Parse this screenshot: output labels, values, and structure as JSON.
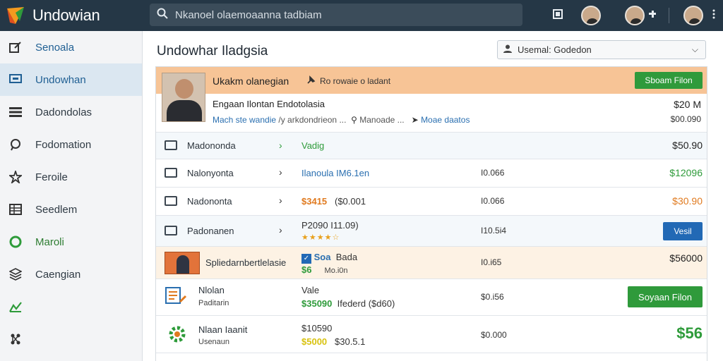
{
  "app": {
    "title": "Undowian",
    "search_text": "Nkanoel olaemoaanna tadbiam"
  },
  "sidebar": {
    "items": [
      {
        "label": "Senoala",
        "icon": "edit-icon"
      },
      {
        "label": "Undowhan",
        "icon": "monitor-icon",
        "active": true
      },
      {
        "label": "Dadondolas",
        "icon": "list-icon"
      },
      {
        "label": "Fodomation",
        "icon": "chat-icon"
      },
      {
        "label": "Feroile",
        "icon": "star-icon"
      },
      {
        "label": "Seedlem",
        "icon": "grid-icon"
      },
      {
        "label": "Maroli",
        "icon": "circle-check-icon"
      },
      {
        "label": "Caengian",
        "icon": "stack-icon"
      },
      {
        "label": "",
        "icon": "graph-icon"
      },
      {
        "label": "",
        "icon": "network-icon"
      }
    ]
  },
  "main": {
    "title": "Undowhar Iladgsia",
    "account_select": "Usemal: Godedon",
    "highlight": {
      "title": "Ukakm olanegian",
      "subtitle": "Ro rowaie o ladant",
      "button": "Sboam Filon",
      "line2": "Engaan Ilontan Endotolasia",
      "line3_link": "Mach ste wandie",
      "line3_rest": "/y arkdondrieon ...",
      "line3_place": "Manoade ...",
      "line3_more": "Moae daatos",
      "amount1": "$20 M",
      "amount2": "$00.090"
    },
    "rows": [
      {
        "name": "Madononda",
        "col2": "Vadig",
        "col2_color": "#2e9b3a",
        "amount": "$50.90",
        "amount_color": "#222222"
      },
      {
        "name": "Nalonyonta",
        "col2": "Ilanoula  IM6.1en",
        "col2_color": "#2a6fb0",
        "col3": "I0.066",
        "amount": "$12096",
        "amount_color": "#2e9b3a"
      },
      {
        "name": "Nadononta",
        "col2_value": "$3415",
        "col2_rest": "($0.001",
        "col3": "I0.066",
        "amount": "$30.90",
        "amount_color": "#e07a1f"
      },
      {
        "name": "Padonanen",
        "col2": "P2090  I11.09)",
        "rating": 4,
        "col3": "I10.5i4",
        "button": "Vesil"
      },
      {
        "name": "Spliedarnbertlelasie",
        "col2_badge": "Soa",
        "col2_b": "Bada",
        "col2_c": "$6",
        "col2_d": "Mo.i0n",
        "col3": "I0.i65",
        "amount": "$56000",
        "amount_color": "#222222"
      },
      {
        "name": "Nlolan",
        "sub": "Paditarin",
        "col2_top": "Vale",
        "col2_green": "$35090",
        "col2_rest": "Ifederd  ($d60)",
        "col3": "$0.i56",
        "button": "Soyaan Filon"
      },
      {
        "name": "Nlaan Iaanit",
        "sub": "Usenaun",
        "col2_top": "$10590",
        "col2_green": "$5000",
        "col2_rest": "$30.5.1",
        "col3": "$0.000",
        "amount": "$56"
      }
    ]
  }
}
